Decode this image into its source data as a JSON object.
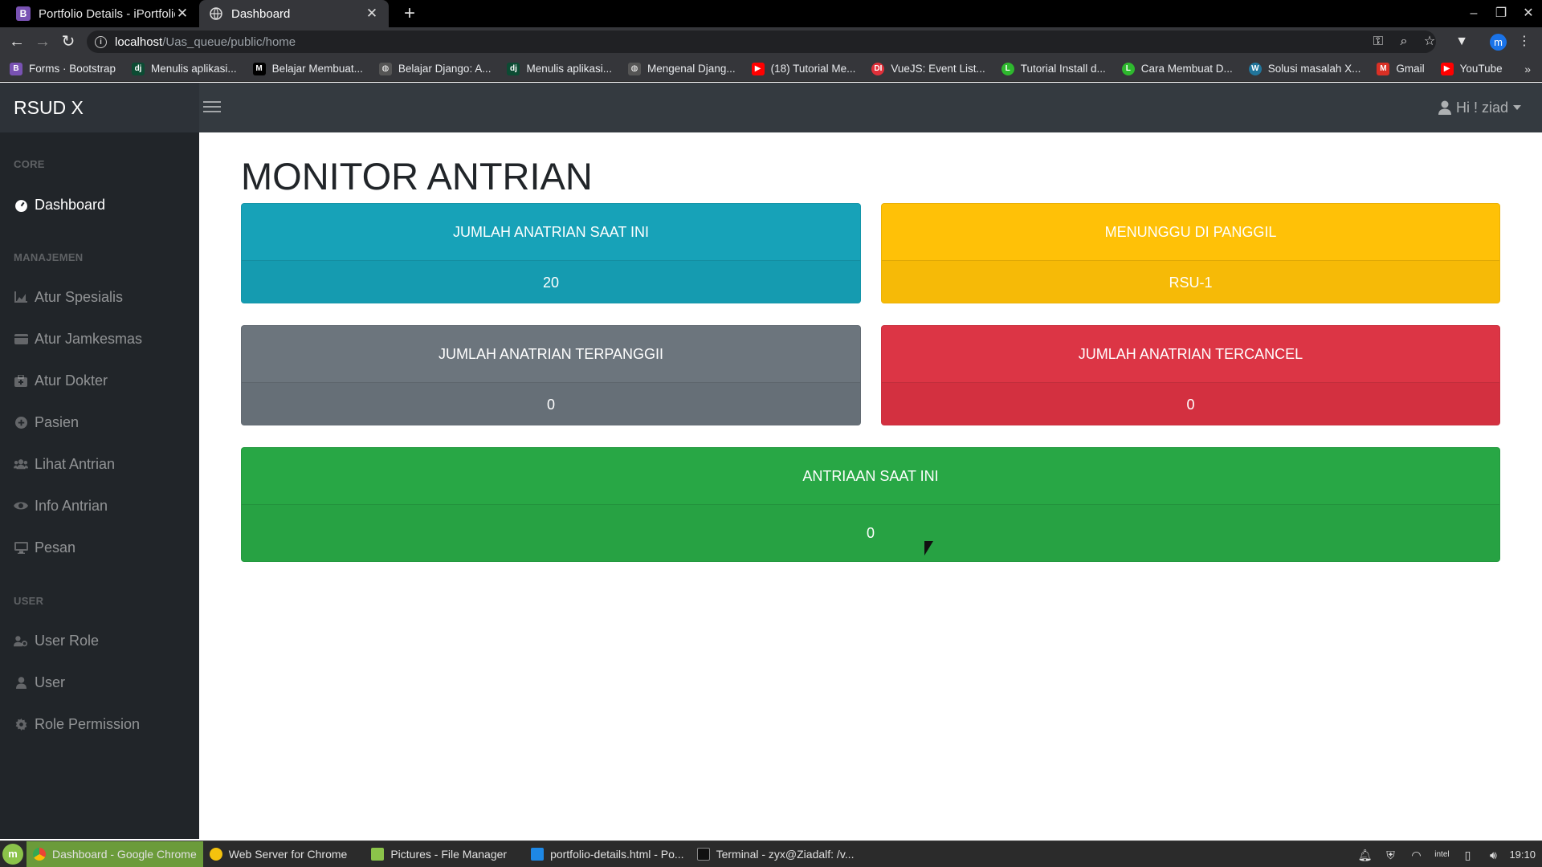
{
  "browser": {
    "tabs": [
      {
        "label": "Portfolio Details - iPortfolio E",
        "favicon": "B",
        "active": false
      },
      {
        "label": "Dashboard",
        "favicon": "globe",
        "active": true
      }
    ],
    "new_tab": "+",
    "url_host": "localhost",
    "url_path": "/Uas_queue/public/home",
    "profile_initial": "m",
    "bookmarks": [
      {
        "label": "Forms · Bootstrap",
        "icon": "B",
        "color": "#7952b3"
      },
      {
        "label": "Menulis aplikasi...",
        "icon": "dj",
        "color": "#0c4b33"
      },
      {
        "label": "Belajar Membuat...",
        "icon": "M",
        "color": "#000000"
      },
      {
        "label": "Belajar Django: A...",
        "icon": "globe",
        "color": "#555555"
      },
      {
        "label": "Menulis aplikasi...",
        "icon": "dj",
        "color": "#0c4b33"
      },
      {
        "label": "Mengenal Djang...",
        "icon": "globe",
        "color": "#555555"
      },
      {
        "label": "(18) Tutorial Me...",
        "icon": "youtube",
        "color": "#ff0000"
      },
      {
        "label": "VueJS: Event List...",
        "icon": "DI",
        "color": "#e0303a"
      },
      {
        "label": "Tutorial Install d...",
        "icon": "L",
        "color": "#2eb82e"
      },
      {
        "label": "Cara Membuat D...",
        "icon": "L",
        "color": "#2eb82e"
      },
      {
        "label": "Solusi masalah X...",
        "icon": "W",
        "color": "#21759b"
      },
      {
        "label": "Gmail",
        "icon": "gmail",
        "color": "#d93025"
      },
      {
        "label": "YouTube",
        "icon": "youtube",
        "color": "#ff0000"
      }
    ],
    "bookmarks_more": "»"
  },
  "app": {
    "brand": "RSUD X",
    "user_menu": "Hi ! ziad",
    "sidebar": {
      "headings": {
        "core": "CORE",
        "manajemen": "MANAJEMEN",
        "user": "USER"
      },
      "items": [
        {
          "label": "Dashboard",
          "icon": "tachometer-icon"
        },
        {
          "label": "Atur Spesialis",
          "icon": "chart-area-icon"
        },
        {
          "label": "Atur Jamkesmas",
          "icon": "credit-card-icon"
        },
        {
          "label": "Atur Dokter",
          "icon": "briefcase-medical-icon"
        },
        {
          "label": "Pasien",
          "icon": "plus-circle-icon"
        },
        {
          "label": "Lihat Antrian",
          "icon": "users-icon"
        },
        {
          "label": "Info Antrian",
          "icon": "eye-icon"
        },
        {
          "label": "Pesan",
          "icon": "desktop-icon"
        },
        {
          "label": "User Role",
          "icon": "user-cog-icon"
        },
        {
          "label": "User",
          "icon": "user-icon"
        },
        {
          "label": "Role Permission",
          "icon": "cog-icon"
        }
      ]
    },
    "main": {
      "title": "MONITOR ANTRIAN",
      "cards": [
        {
          "header": "JUMLAH ANATRIAN SAAT INI",
          "value": "20"
        },
        {
          "header": "MENUNGGU DI PANGGIL",
          "value": "RSU-1"
        },
        {
          "header": "JUMLAH ANATRIAN TERPANGGII",
          "value": "0"
        },
        {
          "header": "JUMLAH ANATRIAN TERCANCEL",
          "value": "0"
        },
        {
          "header": "ANTRIAAN SAAT INI",
          "value": "0"
        }
      ]
    }
  },
  "taskbar": {
    "tasks": [
      {
        "label": "Dashboard - Google Chrome",
        "active": true
      },
      {
        "label": "Web Server for Chrome",
        "active": false
      },
      {
        "label": "Pictures - File Manager",
        "active": false
      },
      {
        "label": "portfolio-details.html - Po...",
        "active": false
      },
      {
        "label": "Terminal - zyx@Ziadalf: /v...",
        "active": false
      }
    ],
    "clock": "19:10"
  },
  "colors": {
    "info": "#17a2b8",
    "warning": "#ffc107",
    "secondary": "#6c757d",
    "danger": "#dc3545",
    "success": "#28a745",
    "navbar": "#343a40",
    "sidebar": "#212529"
  }
}
